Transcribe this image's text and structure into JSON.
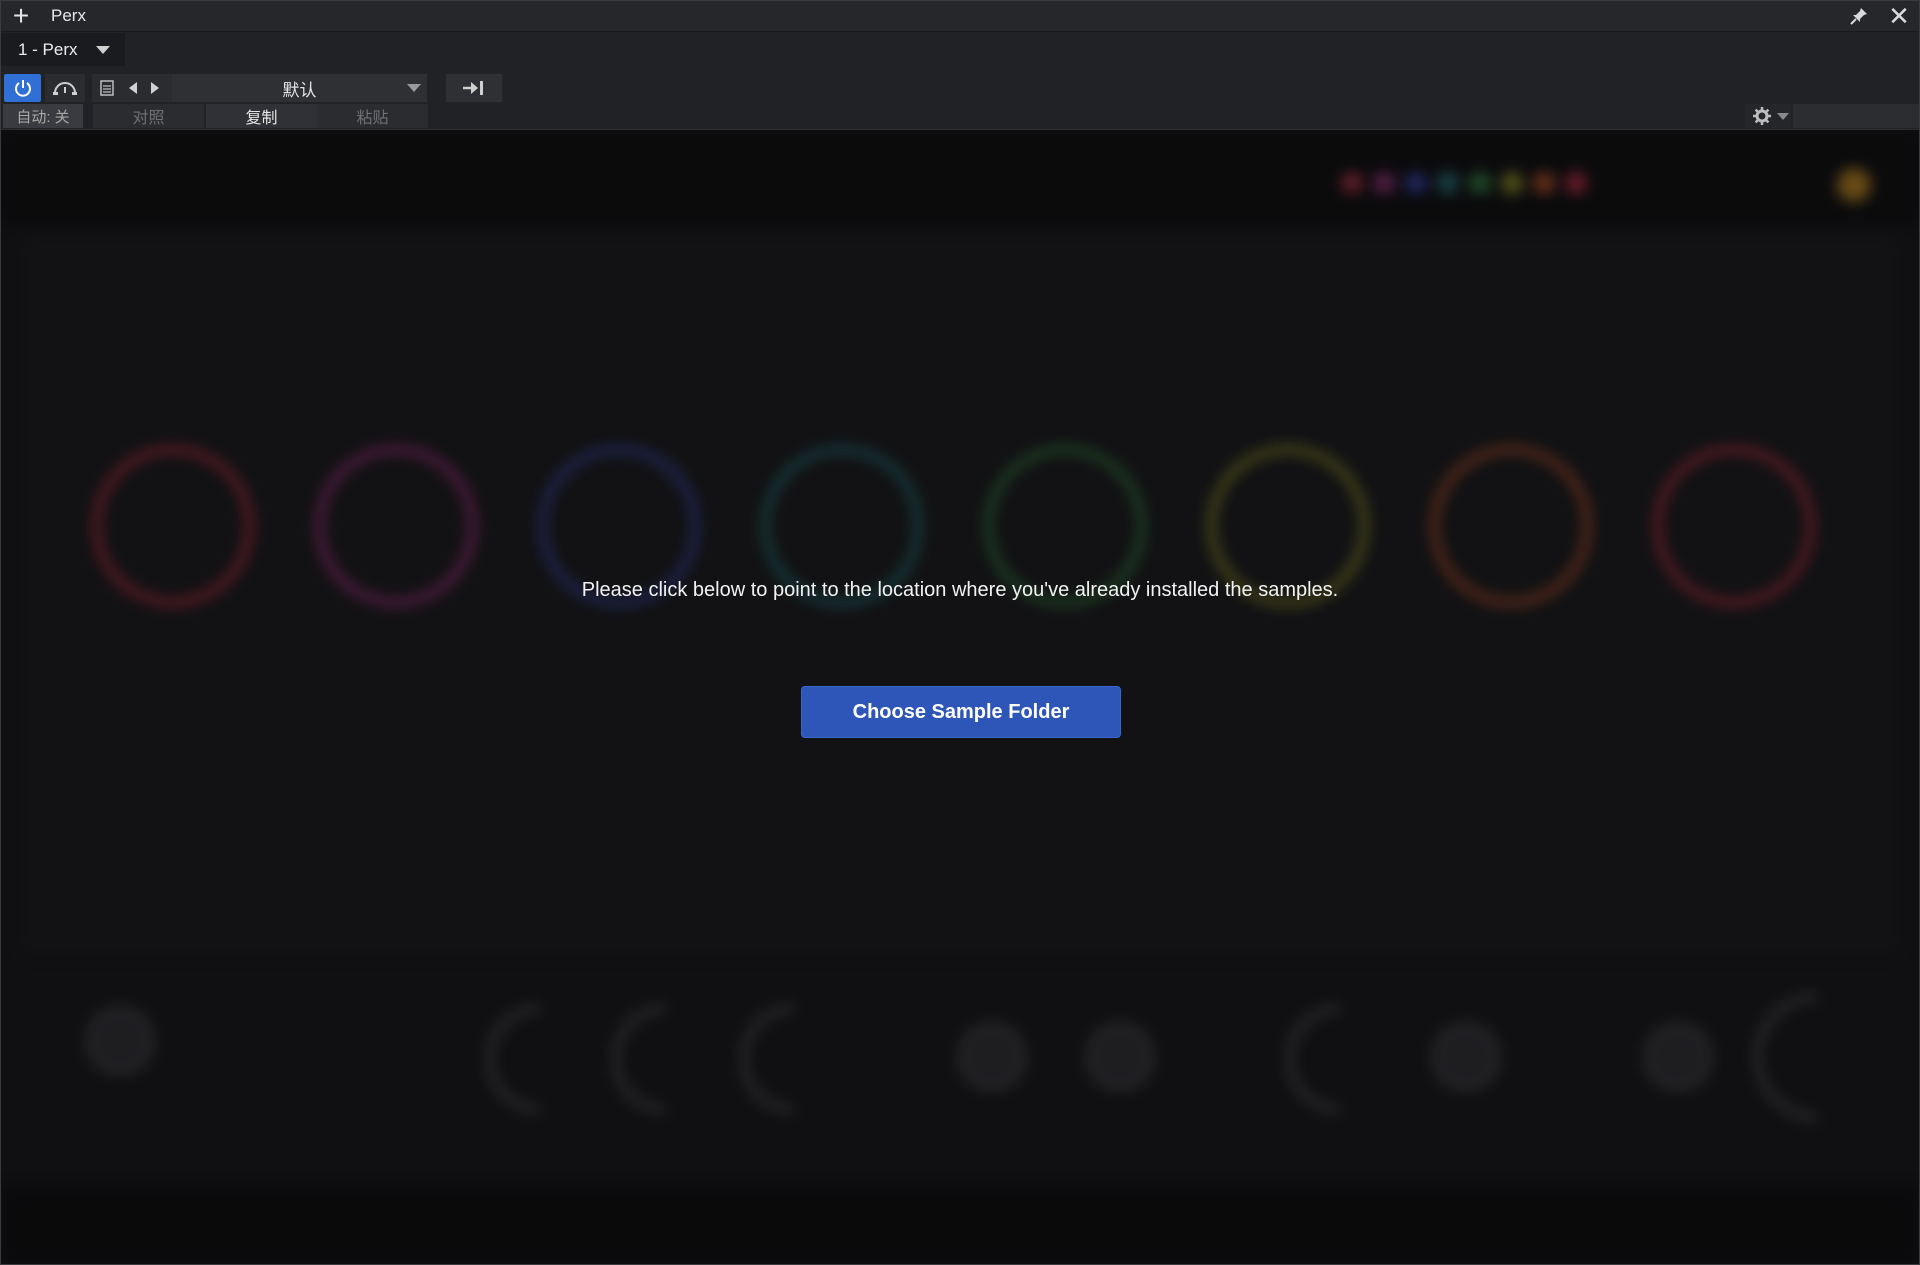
{
  "window": {
    "title": "Perx",
    "new_icon": "plus-icon",
    "pin_icon": "pin-icon",
    "close_icon": "close-icon"
  },
  "header": {
    "instance_tab": "1 - Perx",
    "preset_name": "默认",
    "auto_label": "自动: 关",
    "compare_label": "对照",
    "copy_label": "复制",
    "paste_label": "粘贴"
  },
  "plugin": {
    "message": "Please click below to point to the location where you've already installed the samples.",
    "choose_button": "Choose Sample Folder"
  },
  "colors": {
    "accent": "#2f6fd6",
    "button": "#2d56b8",
    "ring_colors": [
      "#b3283e",
      "#a12a7a",
      "#3340a0",
      "#1f6e70",
      "#2f7a3a",
      "#8a8a22",
      "#b34a22",
      "#b3283e"
    ]
  }
}
